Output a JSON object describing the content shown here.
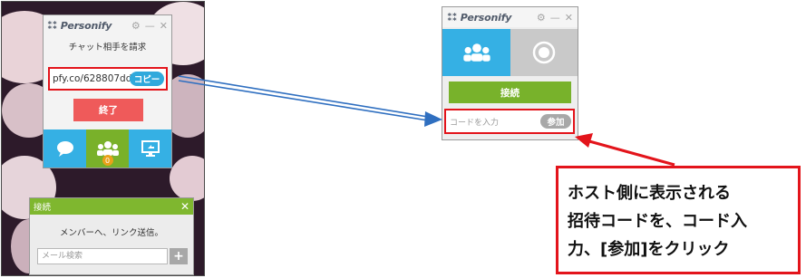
{
  "app_name": "Personify",
  "window_controls": [
    "⚙",
    "—",
    "✕"
  ],
  "host_window": {
    "request_text": "チャット相手を請求",
    "invite_url": "pfy.co/628807dd",
    "copy_label": "コピー",
    "end_label": "終了",
    "people_badge": "0",
    "tabs": [
      "chat-bubble-icon",
      "people-icon",
      "screen-share-icon"
    ]
  },
  "connect_panel": {
    "title": "接続",
    "close_glyph": "✕",
    "send_text": "メンバーへ、リンク送信。",
    "search_placeholder": "メール検索",
    "add_glyph": "+"
  },
  "guest_window": {
    "connect_label": "接続",
    "code_placeholder": "コードを入力",
    "join_label": "参加"
  },
  "callout": {
    "lines": [
      "ホスト側に表示される",
      "招待コードを、コード入",
      "力、[参加]をクリック"
    ]
  },
  "colors": {
    "accent_blue": "#35b0e4",
    "accent_green": "#78b22b",
    "end_red": "#ef5a5a",
    "highlight_red": "#e3141b",
    "arrow_blue": "#2f6fc0"
  }
}
